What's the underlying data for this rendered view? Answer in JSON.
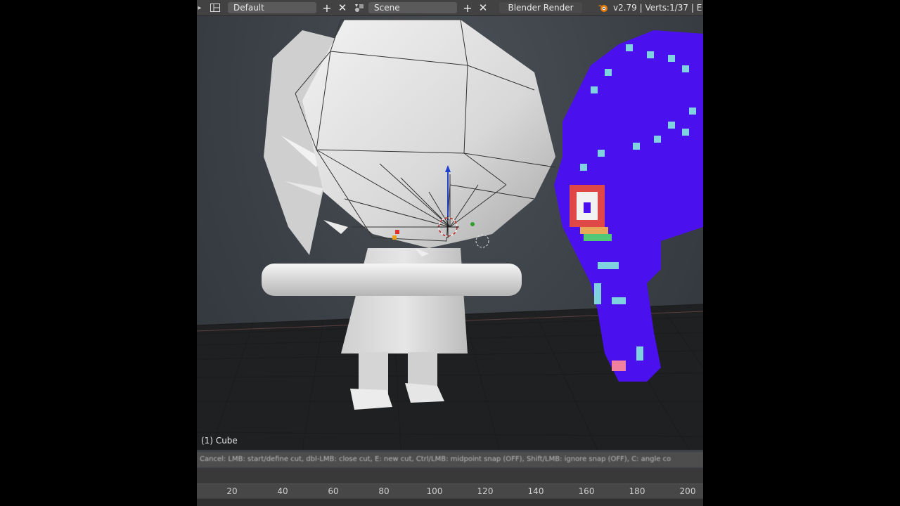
{
  "topbar": {
    "layout_name": "Default",
    "scene_name": "Scene",
    "render_engine": "Blender Render",
    "version_info": "v2.79 | Verts:1/37 | E"
  },
  "viewport": {
    "object_label": "(1) Cube"
  },
  "status": {
    "text": "Cancel: LMB: start/define cut, dbl-LMB: close cut, E: new cut, Ctrl/LMB: midpoint snap (OFF), Shift/LMB: ignore snap (OFF), C: angle co"
  },
  "timeline": {
    "ticks": [
      "20",
      "40",
      "60",
      "80",
      "100",
      "120",
      "140",
      "160",
      "180",
      "200"
    ]
  },
  "colors": {
    "sprite_purple": "#4a10ee",
    "sprite_cyan": "#7fd3e0",
    "ui_bg": "#424242"
  }
}
